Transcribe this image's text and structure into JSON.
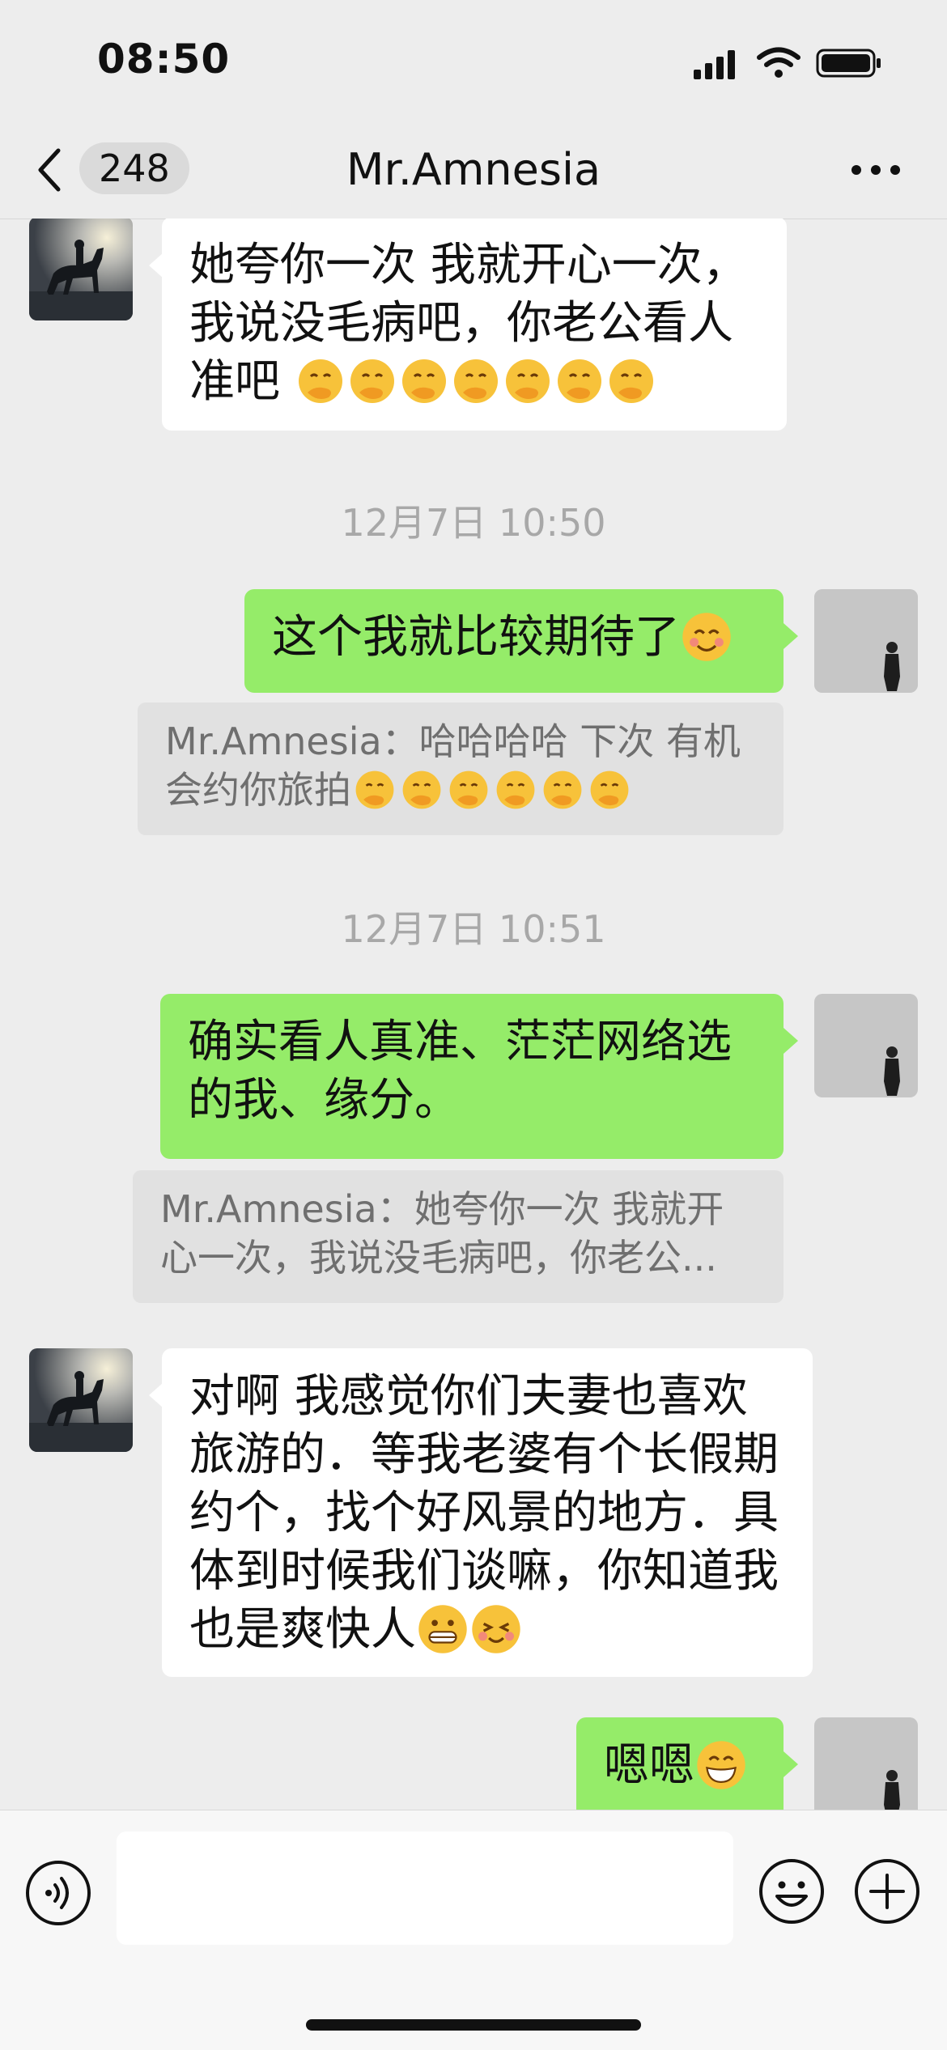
{
  "status": {
    "time": "08:50"
  },
  "nav": {
    "unread_count": "248",
    "title": "Mr.Amnesia"
  },
  "messages": [
    {
      "side": "left",
      "text": "她夸你一次 我就开心一次，我说没毛病吧，你老公看人准吧",
      "emoji_count": 7
    },
    {
      "timestamp": "12月7日 10:50"
    },
    {
      "side": "right",
      "text": "这个我就比较期待了"
    },
    {
      "quote": "Mr.Amnesia：哈哈哈哈 下次 有机会约你旅拍",
      "emoji_count": 6
    },
    {
      "timestamp": "12月7日 10:51"
    },
    {
      "side": "right",
      "text": "确实看人真准、茫茫网络选的我、缘分。"
    },
    {
      "quote": "Mr.Amnesia：她夸你一次 我就开心一次，我说没毛病吧，你老公..."
    },
    {
      "side": "left",
      "text": "对啊 我感觉你们夫妻也喜欢旅游的．等我老婆有个长假期约个，找个好风景的地方．具体到时候我们谈嘛，你知道我也是爽快人"
    },
    {
      "side": "right",
      "text": "嗯嗯"
    }
  ],
  "icons": [
    "voice-icon",
    "emoji-icon",
    "plus-icon",
    "back-chevron-icon",
    "more-icon"
  ],
  "colors": {
    "background": "#ededed",
    "sent_bubble": "#95ec69",
    "received_bubble": "#ffffff",
    "quote_bg": "#e1e1e1"
  }
}
